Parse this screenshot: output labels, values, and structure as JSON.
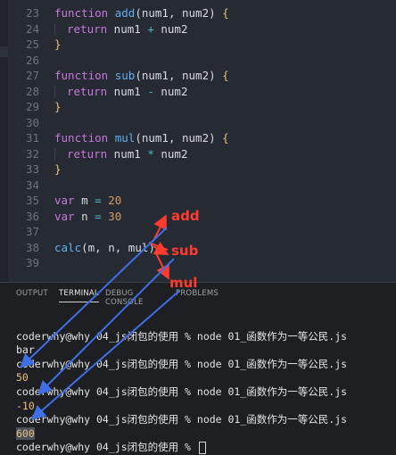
{
  "editor": {
    "lines": [
      {
        "n": "23",
        "kind": "fnhead",
        "kw": "function",
        "name": "add",
        "params": "(num1, num2)",
        "brace": "{"
      },
      {
        "n": "24",
        "kind": "ret",
        "kw": "return",
        "a": "num1",
        "op": "+",
        "b": "num2"
      },
      {
        "n": "25",
        "kind": "close",
        "brace": "}"
      },
      {
        "n": "26",
        "kind": "blank"
      },
      {
        "n": "27",
        "kind": "fnhead",
        "kw": "function",
        "name": "sub",
        "params": "(num1, num2)",
        "brace": "{"
      },
      {
        "n": "28",
        "kind": "ret",
        "kw": "return",
        "a": "num1",
        "op": "-",
        "b": "num2"
      },
      {
        "n": "29",
        "kind": "close",
        "brace": "}"
      },
      {
        "n": "30",
        "kind": "blank"
      },
      {
        "n": "31",
        "kind": "fnhead",
        "kw": "function",
        "name": "mul",
        "params": "(num1, num2)",
        "brace": "{"
      },
      {
        "n": "32",
        "kind": "ret",
        "kw": "return",
        "a": "num1",
        "op": "*",
        "b": "num2"
      },
      {
        "n": "33",
        "kind": "close",
        "brace": "}"
      },
      {
        "n": "34",
        "kind": "blank"
      },
      {
        "n": "35",
        "kind": "var",
        "kw": "var",
        "name": "m",
        "op": "=",
        "val": "20"
      },
      {
        "n": "36",
        "kind": "var",
        "kw": "var",
        "name": "n",
        "op": "=",
        "val": "30"
      },
      {
        "n": "37",
        "kind": "blank"
      },
      {
        "n": "38",
        "kind": "call",
        "name": "calc",
        "args": "(m, n, mul)"
      },
      {
        "n": "39",
        "kind": "blank"
      }
    ]
  },
  "panel": {
    "tabs": [
      {
        "label": "OUTPUT",
        "active": false
      },
      {
        "label": "TERMINAL",
        "active": true
      },
      {
        "label": "DEBUG CONSOLE",
        "active": false
      },
      {
        "label": "PROBLEMS",
        "active": false
      }
    ]
  },
  "terminal": {
    "lines": [
      {
        "text": "",
        "type": "blank"
      },
      {
        "text": "coderwhy@why 04_js闭包的使用 % node 01_函数作为一等公民.js",
        "type": "prompt"
      },
      {
        "text": "bar",
        "type": "output"
      },
      {
        "text": "coderwhy@why 04_js闭包的使用 % node 01_函数作为一等公民.js",
        "type": "prompt"
      },
      {
        "text": "50",
        "type": "result"
      },
      {
        "text": "coderwhy@why 04_js闭包的使用 % node 01_函数作为一等公民.js",
        "type": "prompt"
      },
      {
        "text": "-10",
        "type": "result"
      },
      {
        "text": "coderwhy@why 04_js闭包的使用 % node 01_函数作为一等公民.js",
        "type": "prompt"
      },
      {
        "text": "600",
        "type": "result-hl"
      },
      {
        "text": "coderwhy@why 04_js闭包的使用 % ",
        "type": "prompt-cursor"
      }
    ]
  },
  "annotations": {
    "labels": [
      "add",
      "sub",
      "mul"
    ],
    "color": "#ff3b30",
    "arrow_color": "#3f6fe6"
  }
}
